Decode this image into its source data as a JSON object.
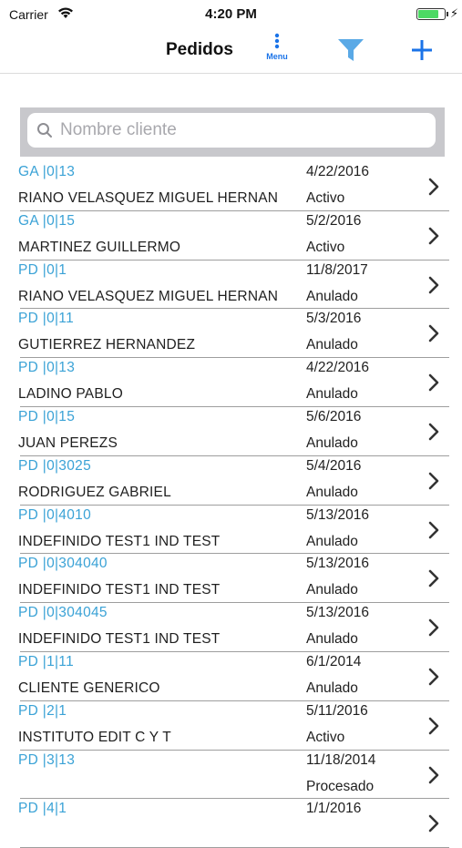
{
  "status_bar": {
    "carrier": "Carrier",
    "time": "4:20 PM",
    "battery_level": 0.85
  },
  "nav": {
    "title": "Pedidos",
    "menu_label": "Menu"
  },
  "search": {
    "placeholder": "Nombre cliente",
    "value": ""
  },
  "colors": {
    "accent": "#1a73e8",
    "code": "#3aa2d6",
    "filter": "#5aa9e6"
  },
  "orders": [
    {
      "code": "GA |0|13",
      "client": "RIANO VELASQUEZ MIGUEL HERNAN",
      "date": "4/22/2016",
      "status": "Activo"
    },
    {
      "code": "GA |0|15",
      "client": "MARTINEZ GUILLERMO",
      "date": "5/2/2016",
      "status": "Activo"
    },
    {
      "code": "PD |0|1",
      "client": "RIANO VELASQUEZ MIGUEL HERNAN",
      "date": "11/8/2017",
      "status": "Anulado"
    },
    {
      "code": "PD |0|11",
      "client": "GUTIERREZ HERNANDEZ",
      "date": "5/3/2016",
      "status": "Anulado"
    },
    {
      "code": "PD |0|13",
      "client": "LADINO PABLO",
      "date": "4/22/2016",
      "status": "Anulado"
    },
    {
      "code": "PD |0|15",
      "client": "JUAN PEREZS",
      "date": "5/6/2016",
      "status": "Anulado"
    },
    {
      "code": "PD |0|3025",
      "client": "RODRIGUEZ GABRIEL",
      "date": "5/4/2016",
      "status": "Anulado"
    },
    {
      "code": "PD |0|4010",
      "client": "INDEFINIDO TEST1 IND TEST",
      "date": "5/13/2016",
      "status": "Anulado"
    },
    {
      "code": "PD |0|304040",
      "client": "INDEFINIDO TEST1 IND TEST",
      "date": "5/13/2016",
      "status": "Anulado"
    },
    {
      "code": "PD |0|304045",
      "client": "INDEFINIDO TEST1 IND TEST",
      "date": "5/13/2016",
      "status": "Anulado"
    },
    {
      "code": "PD |1|11",
      "client": "CLIENTE GENERICO",
      "date": "6/1/2014",
      "status": "Anulado"
    },
    {
      "code": "PD |2|1",
      "client": "INSTITUTO EDIT C Y T",
      "date": "5/11/2016",
      "status": "Activo"
    },
    {
      "code": "PD |3|13",
      "client": "",
      "date": "11/18/2014",
      "status": "Procesado"
    },
    {
      "code": "PD |4|1",
      "client": "",
      "date": "1/1/2016",
      "status": ""
    }
  ]
}
